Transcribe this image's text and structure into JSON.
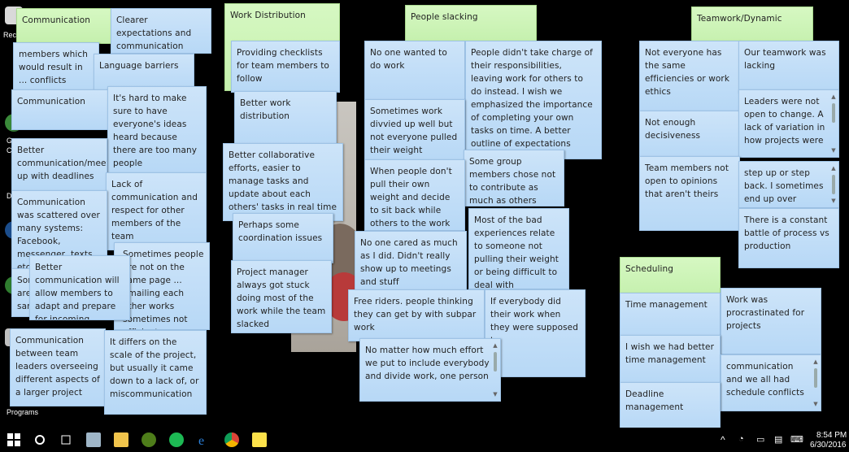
{
  "desktop": {
    "labels": [
      "Rec",
      "G",
      "C",
      "Dr",
      "Programs"
    ]
  },
  "notes": [
    {
      "id": "n1",
      "text": "Communication",
      "green": true
    },
    {
      "id": "n2",
      "text": "Clearer expectations and communication"
    },
    {
      "id": "n3",
      "text": "members which would result in ... conflicts"
    },
    {
      "id": "n4",
      "text": "Language barriers"
    },
    {
      "id": "n5",
      "text": "Communication"
    },
    {
      "id": "n6",
      "text": "It's hard to make sure to have everyone's ideas heard because there are too many people"
    },
    {
      "id": "n7",
      "text": "Better communication/meeting up with deadlines"
    },
    {
      "id": "n8",
      "text": "Lack of communication and respect for other members of the team"
    },
    {
      "id": "n9",
      "text": "Communication was scattered over many systems: Facebook, messenger, texts, etc. Tas..."
    },
    {
      "id": "n10",
      "text": "Sometimes people are not on the same page ... emailing each other works sometimes not efficient"
    },
    {
      "id": "n11",
      "text": "Better communication will allow members to adapt and prepare for incoming situations"
    },
    {
      "id": "n12",
      "text": "Communication between team leaders overseeing different aspects of a larger project"
    },
    {
      "id": "n13",
      "text": "It differs on the scale of the project, but usually it came down to a lack of, or miscommunication"
    },
    {
      "id": "n14",
      "text": "Work Distribution",
      "green": true
    },
    {
      "id": "n15",
      "text": "Providing checklists for team members to follow"
    },
    {
      "id": "n16",
      "text": "Better work distribution"
    },
    {
      "id": "n17",
      "text": "Better collaborative efforts, easier to manage tasks and update about each others' tasks in real time"
    },
    {
      "id": "n18",
      "text": "Perhaps some coordination issues"
    },
    {
      "id": "n19",
      "text": "Project manager always got stuck doing most of the work while the team slacked"
    },
    {
      "id": "n20",
      "text": "People slacking",
      "green": true
    },
    {
      "id": "n21",
      "text": "No one wanted to do work"
    },
    {
      "id": "n22",
      "text": "People didn't take charge of their responsibilities, leaving work for others to do instead. I wish we emphasized the importance of completing your own tasks on time. A better outline of expectations perhaps"
    },
    {
      "id": "n23",
      "text": "Sometimes work divvied up well but not everyone pulled their weight"
    },
    {
      "id": "n24",
      "text": "Some group members chose not to contribute as much as others"
    },
    {
      "id": "n25",
      "text": "When people don't pull their own weight and decide to sit back while others to the work"
    },
    {
      "id": "n26",
      "text": "Most of the bad experiences relate to someone not pulling their weight or being difficult to deal with"
    },
    {
      "id": "n27",
      "text": "No one cared as much as I did. Didn't really show up to meetings and stuff"
    },
    {
      "id": "n28",
      "text": "Free riders. people thinking they can get by with subpar work"
    },
    {
      "id": "n29",
      "text": "If everybody did their work when they were supposed to"
    },
    {
      "id": "n30",
      "text": "No matter how much effort we put to include everybody and divide work, one person"
    },
    {
      "id": "n31",
      "text": "Teamwork/Dynamic",
      "green": true
    },
    {
      "id": "n32",
      "text": "Not everyone has the same efficiencies or work ethics"
    },
    {
      "id": "n33",
      "text": "Our teamwork was lacking"
    },
    {
      "id": "n34",
      "text": "Not enough decisiveness"
    },
    {
      "id": "n35",
      "text": "Leaders were not open to change. A lack of variation in how projects were"
    },
    {
      "id": "n36",
      "text": "Team members not open to opinions that aren't theirs"
    },
    {
      "id": "n37",
      "text": "step up or step back. I sometimes end up over participating or"
    },
    {
      "id": "n38",
      "text": "There is a constant battle of process vs production"
    },
    {
      "id": "n39",
      "text": "Scheduling",
      "green": true
    },
    {
      "id": "n40",
      "text": "Time management"
    },
    {
      "id": "n41",
      "text": "Work was procrastinated for projects"
    },
    {
      "id": "n42",
      "text": "I wish we had better time management"
    },
    {
      "id": "n43",
      "text": "communication and we all had schedule conflicts"
    },
    {
      "id": "n44",
      "text": "Deadline management"
    }
  ],
  "taskbar": {
    "time": "8:54 PM",
    "date": "6/30/2016"
  }
}
